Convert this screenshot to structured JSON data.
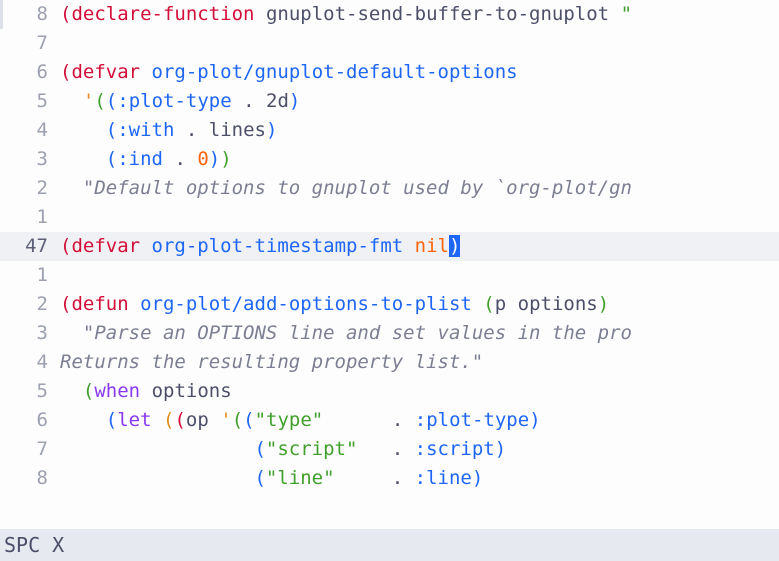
{
  "lines": [
    {
      "gutter": "8"
    },
    {
      "gutter": "7"
    },
    {
      "gutter": "6"
    },
    {
      "gutter": "5"
    },
    {
      "gutter": "4"
    },
    {
      "gutter": "3"
    },
    {
      "gutter": "2"
    },
    {
      "gutter": "1"
    },
    {
      "gutter": "47",
      "current": true
    },
    {
      "gutter": "1"
    },
    {
      "gutter": "2"
    },
    {
      "gutter": "3"
    },
    {
      "gutter": "4"
    },
    {
      "gutter": "5"
    },
    {
      "gutter": "6"
    },
    {
      "gutter": "7"
    },
    {
      "gutter": "8"
    }
  ],
  "tokens": {
    "l0": {
      "p1": "(",
      "declare": "declare-function",
      "sp1": " ",
      "fn": "gnuplot-send-buffer-to-gnuplot",
      "sp2": " ",
      "str": "\""
    },
    "l2": {
      "p1": "(",
      "defvar": "defvar",
      "sp": " ",
      "name": "org-plot/gnuplot-default-options"
    },
    "l3": {
      "indent": "  ",
      "quote": "'",
      "p2": "(",
      "p3": "(",
      "key": ":plot-type",
      "sp": " ",
      "dot": ".",
      "sp2": " ",
      "val": "2d",
      "p3c": ")"
    },
    "l4": {
      "indent": "    ",
      "p3": "(",
      "key": ":with",
      "sp": " ",
      "dot": ".",
      "sp2": " ",
      "val": "lines",
      "p3c": ")"
    },
    "l5": {
      "indent": "    ",
      "p3": "(",
      "key": ":ind",
      "sp": " ",
      "dot": ".",
      "sp2": " ",
      "val": "0",
      "p3c": ")",
      "p2c": ")"
    },
    "l6": {
      "indent": "  ",
      "doc": "\"Default options to gnuplot used by `org-plot/gn"
    },
    "l8": {
      "p1": "(",
      "defvar": "defvar",
      "sp": " ",
      "name": "org-plot-timestamp-fmt",
      "sp2": " ",
      "nil": "nil",
      "p1c": ")"
    },
    "l10": {
      "p1": "(",
      "defun": "defun",
      "sp": " ",
      "name": "org-plot/add-options-to-plist",
      "sp2": " ",
      "p2": "(",
      "arg1": "p",
      "sp3": " ",
      "arg2": "options",
      "p2c": ")"
    },
    "l11": {
      "indent": "  ",
      "doc": "\"Parse an OPTIONS line and set values in the pro"
    },
    "l12": {
      "doc": "Returns the resulting property list.\""
    },
    "l13": {
      "indent": "  ",
      "p2": "(",
      "when": "when",
      "sp": " ",
      "sym": "options"
    },
    "l14": {
      "indent": "    ",
      "p3": "(",
      "let": "let",
      "sp": " ",
      "p4a": "(",
      "p4b": "(",
      "sym": "op",
      "sp2": " ",
      "quote": "'",
      "p5a": "(",
      "p5b": "(",
      "str": "\"type\"",
      "pad": "      ",
      "dot": ".",
      "sp3": " ",
      "key": ":plot-type",
      "p5bc": ")"
    },
    "l15": {
      "indent": "                 ",
      "p5b": "(",
      "str": "\"script\"",
      "pad": "   ",
      "dot": ".",
      "sp": " ",
      "key": ":script",
      "p5bc": ")"
    },
    "l16": {
      "indent": "                 ",
      "p5b": "(",
      "str": "\"line\"",
      "pad": "     ",
      "dot": ".",
      "sp": " ",
      "key": ":line",
      "p5bc": ")"
    }
  },
  "statusbar": {
    "text": "SPC X"
  }
}
